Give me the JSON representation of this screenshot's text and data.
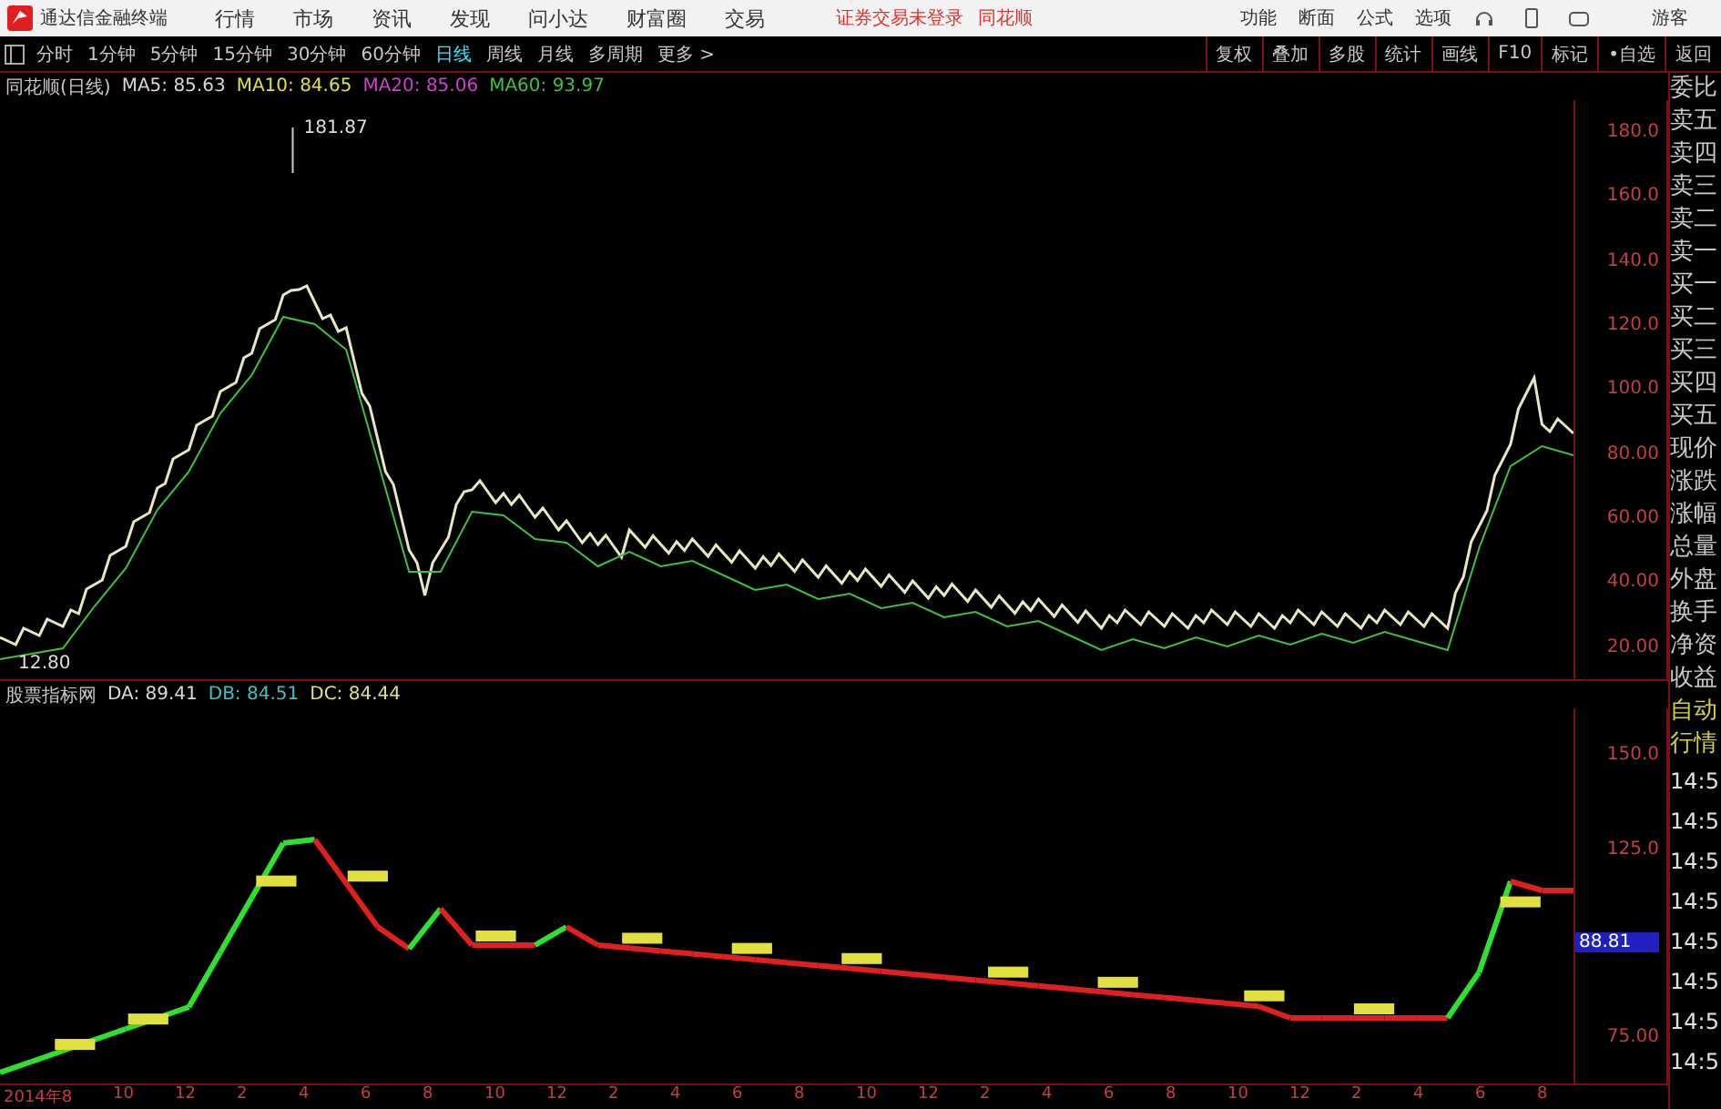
{
  "app_bar": {
    "title": "通达信金融终端",
    "menus": [
      "行情",
      "市场",
      "资讯",
      "发现",
      "问小达",
      "财富圈",
      "交易"
    ],
    "login_notice": "证券交易未登录",
    "broker": "同花顺",
    "tools": [
      "功能",
      "断面",
      "公式",
      "选项"
    ],
    "user": "游客"
  },
  "toolbar": {
    "periods": [
      {
        "label": "分时",
        "selected": false
      },
      {
        "label": "1分钟",
        "selected": false
      },
      {
        "label": "5分钟",
        "selected": false
      },
      {
        "label": "15分钟",
        "selected": false
      },
      {
        "label": "30分钟",
        "selected": false
      },
      {
        "label": "60分钟",
        "selected": false
      },
      {
        "label": "日线",
        "selected": true
      },
      {
        "label": "周线",
        "selected": false
      },
      {
        "label": "月线",
        "selected": false
      },
      {
        "label": "多周期",
        "selected": false
      },
      {
        "label": "更多 >",
        "selected": false
      }
    ],
    "buttons": [
      "复权",
      "叠加",
      "多股",
      "统计",
      "画线",
      "F10",
      "标记",
      "•自选",
      "返回"
    ]
  },
  "main_chart": {
    "title": "同花顺(日线)",
    "indicators": [
      {
        "text": "MA5: 85.63",
        "color": "#d8d8d8"
      },
      {
        "text": "MA10: 84.65",
        "color": "#e0e040"
      },
      {
        "text": "MA20: 85.06",
        "color": "#d040d0"
      },
      {
        "text": "MA60: 93.97",
        "color": "#40c040"
      }
    ],
    "high_label": "181.87",
    "low_label": "12.80",
    "y_ticks": [
      "180.0",
      "160.0",
      "140.0",
      "120.0",
      "100.0",
      "80.00",
      "60.00",
      "40.00",
      "20.00"
    ]
  },
  "sub_chart": {
    "title": "股票指标网",
    "indicators": [
      {
        "text": "DA: 89.41",
        "color": "#d8d8d8"
      },
      {
        "text": "DB: 84.51",
        "color": "#40c0c0"
      },
      {
        "text": "DC: 84.44",
        "color": "#e0e080"
      }
    ],
    "y_ticks": [
      "150.0",
      "125.0",
      "75.00"
    ],
    "current_value": "88.81"
  },
  "x_axis": [
    "2014年8",
    "10",
    "12",
    "2",
    "4",
    "6",
    "8",
    "10",
    "12",
    "2",
    "4",
    "6",
    "8",
    "10",
    "12",
    "2",
    "4",
    "6",
    "8",
    "10",
    "12",
    "2",
    "4",
    "6",
    "8"
  ],
  "side_panel": {
    "labels": [
      "委比",
      "卖五",
      "卖四",
      "卖三",
      "卖二",
      "卖一",
      "买一",
      "买二",
      "买三",
      "买四",
      "买五",
      "现价",
      "涨跌",
      "涨幅",
      "总量",
      "外盘",
      "换手",
      "净资",
      "收益"
    ],
    "tabs": [
      "自动",
      "行情"
    ],
    "times": [
      "14:5",
      "14:5",
      "14:5",
      "14:5",
      "14:5",
      "14:5",
      "14:5",
      "14:5"
    ]
  }
}
